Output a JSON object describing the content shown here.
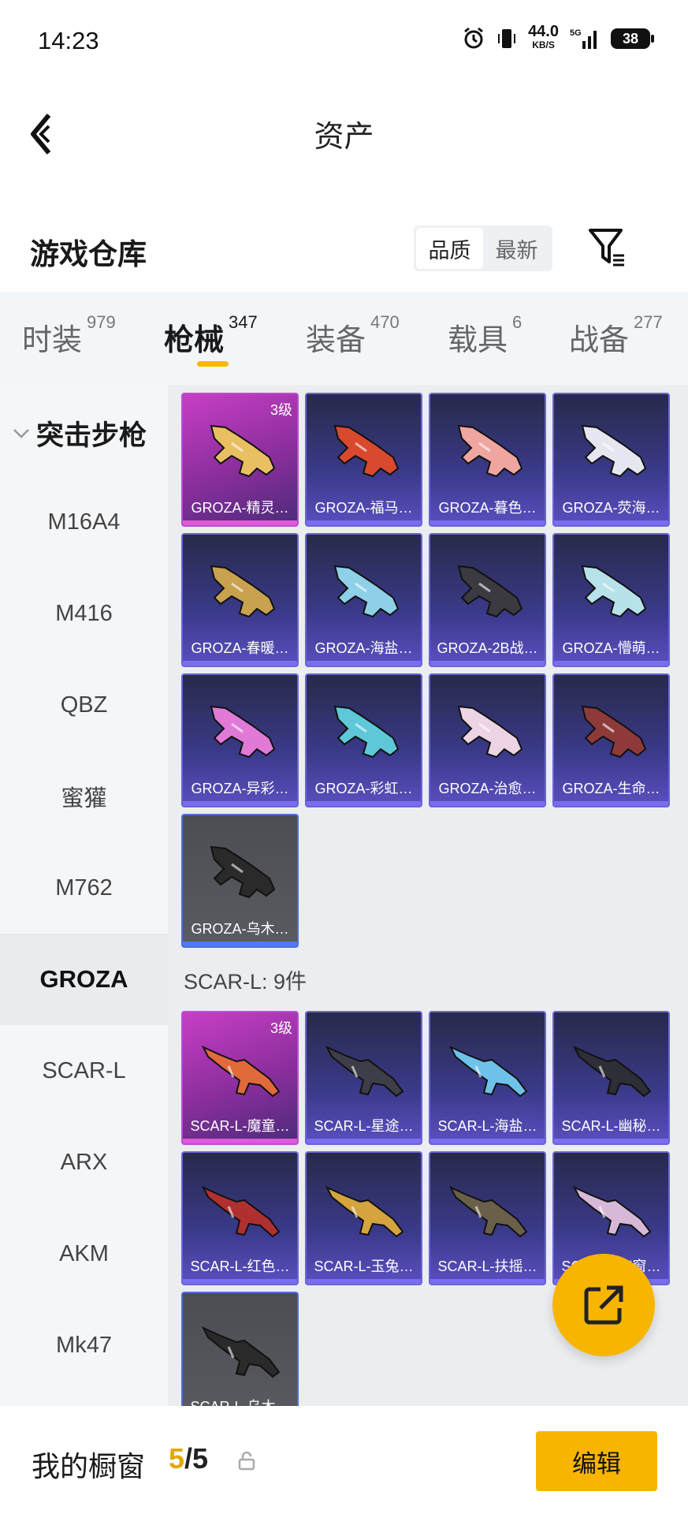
{
  "status": {
    "time": "14:23",
    "net_speed": "44.0",
    "net_unit": "KB/S",
    "battery": "38",
    "signal": "5G"
  },
  "header": {
    "title": "资产"
  },
  "warehouse": {
    "title": "游戏仓库",
    "sort_options": [
      "品质",
      "最新"
    ],
    "sort_selected": "品质"
  },
  "tabs": [
    {
      "label": "时装",
      "count": "979"
    },
    {
      "label": "枪械",
      "count": "347",
      "active": true
    },
    {
      "label": "装备",
      "count": "470"
    },
    {
      "label": "载具",
      "count": "6"
    },
    {
      "label": "战备",
      "count": "277"
    }
  ],
  "sidebar": {
    "category": "突击步枪",
    "items": [
      "M16A4",
      "M416",
      "QBZ",
      "蜜獾",
      "M762",
      "GROZA",
      "SCAR-L",
      "ARX",
      "AKM",
      "Mk47"
    ],
    "active": "GROZA"
  },
  "groza": {
    "cards": [
      {
        "label": "GROZA-精灵…",
        "level": "3级",
        "tier": "gold",
        "color": "#e8c062"
      },
      {
        "label": "GROZA-福马…",
        "tier": "purple",
        "color": "#d9492e"
      },
      {
        "label": "GROZA-暮色…",
        "tier": "purple",
        "color": "#f0a6a0"
      },
      {
        "label": "GROZA-荧海…",
        "tier": "purple",
        "color": "#e6e6f0"
      },
      {
        "label": "GROZA-春暖…",
        "tier": "purple",
        "color": "#c8a24e"
      },
      {
        "label": "GROZA-海盐…",
        "tier": "purple",
        "color": "#8ed0e8"
      },
      {
        "label": "GROZA-2B战…",
        "tier": "purple",
        "color": "#3a3a40"
      },
      {
        "label": "GROZA-懵萌…",
        "tier": "purple",
        "color": "#b8e2ea"
      },
      {
        "label": "GROZA-异彩…",
        "tier": "purple",
        "color": "#e07ad6"
      },
      {
        "label": "GROZA-彩虹…",
        "tier": "purple",
        "color": "#5ec8d8"
      },
      {
        "label": "GROZA-治愈…",
        "tier": "purple",
        "color": "#ecd4e4"
      },
      {
        "label": "GROZA-生命…",
        "tier": "purple",
        "color": "#8e3a3a"
      },
      {
        "label": "GROZA-乌木…",
        "tier": "grey",
        "color": "#2a2a2a"
      }
    ]
  },
  "scar": {
    "section_title": "SCAR-L: 9件",
    "cards": [
      {
        "label": "SCAR-L-魔童…",
        "level": "3级",
        "tier": "gold",
        "color": "#e06a3a"
      },
      {
        "label": "SCAR-L-星途…",
        "tier": "purple",
        "color": "#3e3e48"
      },
      {
        "label": "SCAR-L-海盐…",
        "tier": "purple",
        "color": "#6ec2ea"
      },
      {
        "label": "SCAR-L-幽秘…",
        "tier": "purple",
        "color": "#2e2e36"
      },
      {
        "label": "SCAR-L-红色…",
        "tier": "purple",
        "color": "#b03030"
      },
      {
        "label": "SCAR-L-玉兔…",
        "tier": "purple",
        "color": "#d6a43e"
      },
      {
        "label": "SCAR-L-扶摇…",
        "tier": "purple",
        "color": "#6a604a"
      },
      {
        "label": "SCAR-L-幽窗…",
        "tier": "purple",
        "color": "#d8b8d8"
      },
      {
        "label": "SCAR-L-乌木…",
        "tier": "grey",
        "color": "#2a2a2a"
      }
    ]
  },
  "bottom": {
    "title": "我的橱窗",
    "count_current": "5",
    "count_sep": "/",
    "count_total": "5",
    "edit_label": "编辑"
  },
  "colors": {
    "accent": "#f7b500",
    "purple_card": "#3a3a8a",
    "gold_card": "#c73ec5"
  }
}
